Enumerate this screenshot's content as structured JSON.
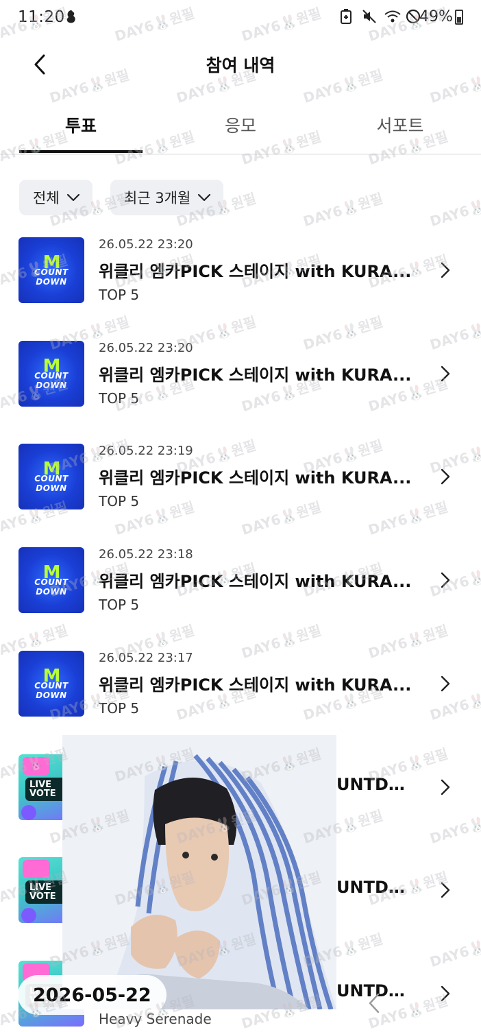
{
  "status_bar": {
    "time": "11:20",
    "battery": "49%",
    "icons": [
      "app-notification-icon",
      "battery-saver-icon",
      "mute-icon",
      "wifi-icon",
      "do-not-disturb-icon",
      "battery-icon"
    ]
  },
  "header": {
    "title": "참여 내역",
    "back_icon": "chevron-left-icon"
  },
  "tabs": [
    {
      "label": "투표",
      "active": true
    },
    {
      "label": "응모",
      "active": false
    },
    {
      "label": "서포트",
      "active": false
    }
  ],
  "filters": [
    {
      "label": "전체"
    },
    {
      "label": "최근 3개월"
    }
  ],
  "thumbnails": {
    "mcountdown": {
      "m": "M",
      "line1": "COUNT",
      "line2": "DOWN"
    },
    "live_vote": {
      "line1": "LIVE",
      "line2": "VOTE"
    }
  },
  "items": [
    {
      "date": "26.05.22 23:20",
      "title": "위클리 엠카PICK 스테이지 with KURA...",
      "sub": "TOP 5",
      "thumb": "mcountdown"
    },
    {
      "date": "26.05.22 23:20",
      "title": "위클리 엠카PICK 스테이지 with KURA...",
      "sub": "TOP 5",
      "thumb": "mcountdown"
    },
    {
      "date": "26.05.22 23:19",
      "title": "위클리 엠카PICK 스테이지 with KURA...",
      "sub": "TOP 5",
      "thumb": "mcountdown"
    },
    {
      "date": "26.05.22 23:18",
      "title": "위클리 엠카PICK 스테이지 with KURA...",
      "sub": "TOP 5",
      "thumb": "mcountdown"
    },
    {
      "date": "26.05.22 23:17",
      "title": "위클리 엠카PICK 스테이지 with KURA...",
      "sub": "TOP 5",
      "thumb": "mcountdown"
    },
    {
      "date": "",
      "title": "UNTD...",
      "sub": "",
      "thumb": "live"
    },
    {
      "date": "",
      "title": "UNTD...",
      "sub": "",
      "thumb": "live"
    },
    {
      "date": "",
      "title": "UNTD...",
      "sub": "Heavy Serenade",
      "thumb": "live"
    }
  ],
  "video_overlay": {
    "date": "2026-05-22"
  },
  "watermark": "DAY6🐰원필",
  "colors": {
    "filter_bg": "#eef0f3",
    "mc_blue": "#1a3fd6",
    "mc_green": "#b8ff3a",
    "live_teal": "#3dc7c5"
  }
}
